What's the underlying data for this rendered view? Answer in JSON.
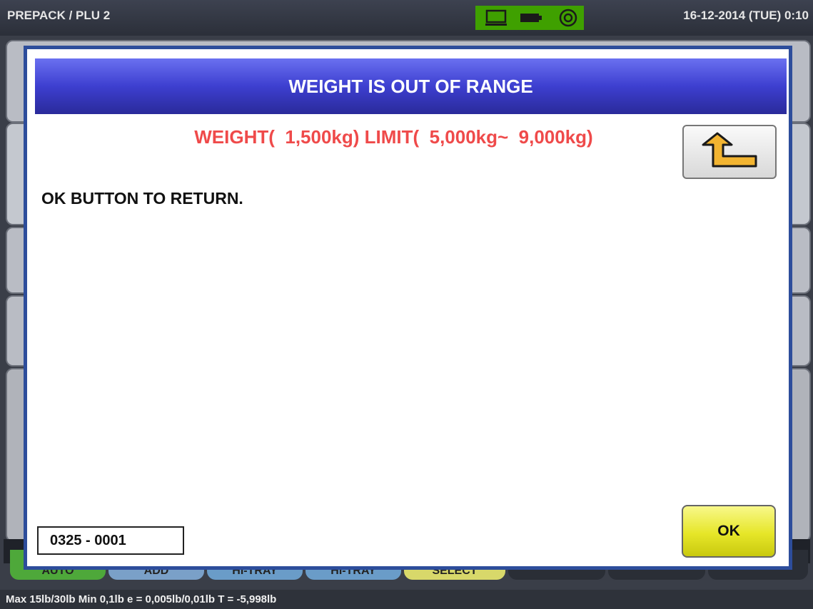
{
  "topbar": {
    "title": "PREPACK / PLU 2",
    "datetime": "16-12-2014 (TUE)  0:10"
  },
  "status_icons": [
    "monitor-icon",
    "battery-icon",
    "network-icon"
  ],
  "background_tabs": [
    "AUTO",
    "ADD",
    "HI-TRAY",
    "HI-TRAY",
    "SELECT"
  ],
  "dialog": {
    "title": "WEIGHT IS OUT OF RANGE",
    "error": "WEIGHT(  1,500kg) LIMIT(  5,000kg~  9,000kg)",
    "message": "OK BUTTON TO RETURN.",
    "code": "0325 - 0001",
    "ok_label": "OK",
    "return_icon": "return-arrow-icon"
  },
  "statusbar": {
    "text": "Max 15lb/30lb  Min 0,1lb  e = 0,005lb/0,01lb  T = -5,998lb"
  },
  "colors": {
    "header_blue": "#3d3fd0",
    "error_red": "#ef4a4a",
    "ok_yellow": "#e6e628",
    "return_arrow": "#f2b431"
  }
}
